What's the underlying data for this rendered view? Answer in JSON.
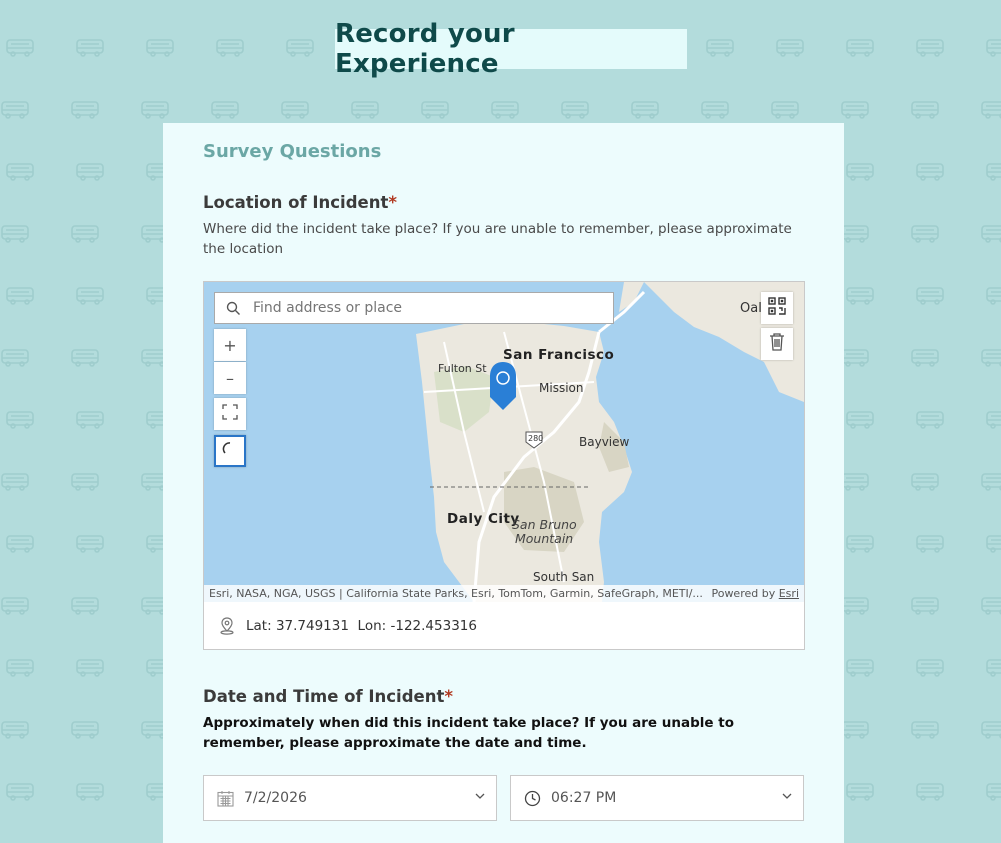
{
  "header": {
    "title": "Record your Experience"
  },
  "survey": {
    "section_title": "Survey Questions",
    "q1": {
      "title": "Location of Incident",
      "required_mark": "*",
      "description": "Where did the incident take place? If you are unable to remember, please approximate the location"
    },
    "map": {
      "search_placeholder": "Find address or place",
      "zoom_in_label": "+",
      "zoom_out_label": "–",
      "labels": {
        "san_francisco": "San Francisco",
        "fulton": "Fulton St",
        "mission": "Mission",
        "bayview": "Bayview",
        "daly_city": "Daly City",
        "san_bruno_1": "San Bruno",
        "san_bruno_2": "Mountain",
        "south_san": "South San",
        "oak": "Oal",
        "highway": "280"
      },
      "attribution": "Esri, NASA, NGA, USGS | California State Parks, Esri, TomTom, Garmin, SafeGraph, METI/...",
      "powered_by": "Powered by ",
      "esri": "Esri"
    },
    "coords": {
      "lat_label": "Lat:",
      "lat": "37.749131",
      "lon_label": "Lon:",
      "lon": "-122.453316"
    },
    "q2": {
      "title": "Date and Time of Incident",
      "required_mark": "*",
      "description": "Approximately when did this incident take place? If you are unable to remember, please approximate the date and time."
    },
    "date_value": "7/2/2026",
    "time_value": "06:27 PM"
  },
  "colors": {
    "background": "#b3dcdc",
    "card": "#edfcfd",
    "title": "#0f4a4a",
    "section": "#6ba7a5",
    "required": "#b13a22",
    "marker": "#2a7fd6"
  }
}
